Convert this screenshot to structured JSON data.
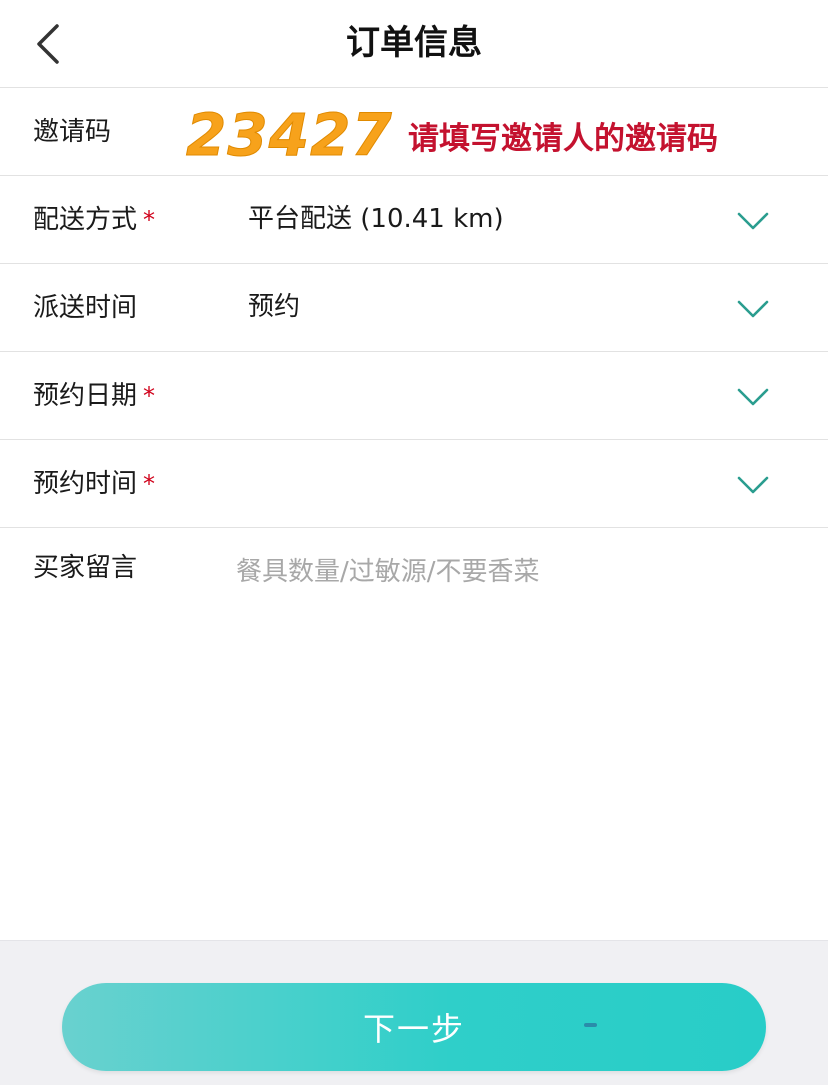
{
  "header": {
    "title": "订单信息"
  },
  "invite": {
    "label": "邀请码",
    "code": "23427",
    "note": "请填写邀请人的邀请码"
  },
  "delivery_method": {
    "label": "配送方式",
    "required_mark": "*",
    "value": "平台配送 (10.41 km)"
  },
  "delivery_time": {
    "label": "派送时间",
    "value": "预约"
  },
  "reservation_date": {
    "label": "预约日期",
    "required_mark": "*"
  },
  "reservation_time": {
    "label": "预约时间",
    "required_mark": "*"
  },
  "buyer_message": {
    "label": "买家留言",
    "placeholder": "餐具数量/过敏源/不要香菜"
  },
  "footer": {
    "next_label": "下一步"
  },
  "colors": {
    "accent": "#2fcfc9",
    "chevron": "#2a9d8f",
    "required": "#d0021b",
    "invite_code": "#f7a21b",
    "invite_note": "#c4122f"
  }
}
